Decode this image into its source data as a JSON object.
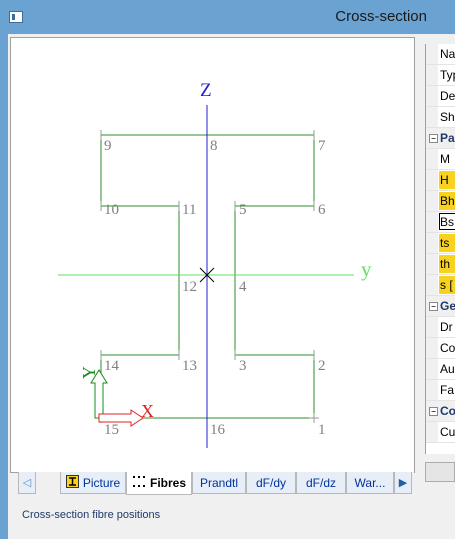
{
  "window": {
    "title": "Cross-section"
  },
  "status_text": "Cross-section fibre positions",
  "tabs": [
    {
      "label": "Picture",
      "icon": "i-beam-icon"
    },
    {
      "label": "Fibres",
      "icon": "dots-icon"
    },
    {
      "label": "Prandtl"
    },
    {
      "label": "dF/dy"
    },
    {
      "label": "dF/dz"
    },
    {
      "label": "War..."
    }
  ],
  "properties": [
    {
      "type": "row",
      "label": "Nar"
    },
    {
      "type": "row",
      "label": "Typ"
    },
    {
      "type": "row",
      "label": "Det"
    },
    {
      "type": "row",
      "label": "Sha"
    },
    {
      "type": "cat",
      "label": "Pa",
      "toggle": "−"
    },
    {
      "type": "row",
      "label": "M"
    },
    {
      "type": "hl",
      "label": "H"
    },
    {
      "type": "hl",
      "label": "Bh"
    },
    {
      "type": "sel",
      "label": "Bs"
    },
    {
      "type": "hl",
      "label": "ts"
    },
    {
      "type": "hl",
      "label": "th"
    },
    {
      "type": "hl",
      "label": "s ["
    },
    {
      "type": "cat",
      "label": "Ge",
      "toggle": "−"
    },
    {
      "type": "row",
      "label": "Dr"
    },
    {
      "type": "row",
      "label": "Co"
    },
    {
      "type": "row",
      "label": "Au"
    },
    {
      "type": "row",
      "label": "Fa"
    },
    {
      "type": "cat",
      "label": "Co",
      "toggle": "−"
    },
    {
      "type": "row",
      "label": "Cu"
    }
  ],
  "drawing": {
    "axis_labels": {
      "z": "Z",
      "y": "y",
      "local_y": "Y",
      "local_x": "X"
    },
    "fibre_points": [
      "1",
      "2",
      "3",
      "4",
      "5",
      "6",
      "7",
      "8",
      "9",
      "10",
      "11",
      "12",
      "13",
      "14",
      "15",
      "16"
    ],
    "colors": {
      "outline": "#2e8b2e",
      "z_axis": "#2020d0",
      "y_axis": "#5fe05f",
      "local_x": "#e02020",
      "local_y": "#1a8a1a",
      "fibre_label": "#808080"
    }
  }
}
